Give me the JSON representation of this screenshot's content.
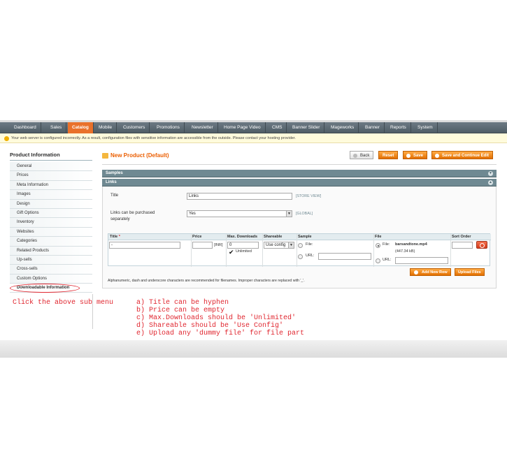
{
  "nav": {
    "items": [
      "Dashboard",
      "Sales",
      "Catalog",
      "Mobile",
      "Customers",
      "Promotions",
      "Newsletter",
      "Home Page Video",
      "CMS",
      "Banner Slider",
      "Mageworks",
      "Banner",
      "Reports",
      "System"
    ],
    "active": "Catalog"
  },
  "notice": {
    "text": "Your web server is configured incorrectly. As a result, configuration files with sensitive information are accessible from the outside. Please contact your hosting provider."
  },
  "sidebar": {
    "title": "Product Information",
    "items": [
      "General",
      "Prices",
      "Meta Information",
      "Images",
      "Design",
      "Gift Options",
      "Inventory",
      "Websites",
      "Categories",
      "Related Products",
      "Up-sells",
      "Cross-sells",
      "Custom Options",
      "Downloadable Information"
    ],
    "selected": "Downloadable Information"
  },
  "header": {
    "title": "New Product (Default)",
    "back_label": "Back",
    "reset_label": "Reset",
    "save_label": "Save",
    "save_continue_label": "Save and Continue Edit"
  },
  "sections": {
    "samples": "Samples",
    "links": "Links"
  },
  "links_form": {
    "title_label": "Title",
    "title_value": "Links",
    "title_scope": "[STORE VIEW]",
    "purchase_label_line1": "Links can be purchased",
    "purchase_label_line2": "separately",
    "purchase_value": "Yes",
    "purchase_scope": "[GLOBAL]"
  },
  "grid": {
    "headers": {
      "title": "Title",
      "required_mark": "*",
      "price": "Price",
      "max_downloads": "Max. Downloads",
      "shareable": "Shareable",
      "sample": "Sample",
      "file": "File",
      "sort_order": "Sort Order"
    },
    "row": {
      "title_value": "-",
      "price_currency": "[INR]",
      "max_downloads_value": "0",
      "unlimited_label": "Unlimited",
      "shareable_value": "Use config",
      "sample_file_label": "File:",
      "sample_url_label": "URL:",
      "file_label": "File:",
      "file_name": "barsandtone.mp4",
      "file_size": "(447.34 kB)",
      "file_url_label": "URL:"
    },
    "add_new_row_label": "Add New Row",
    "upload_files_label": "Upload Files",
    "note": "Alphanumeric, dash and underscore characters are recommended for filenames. Improper characters are replaced with '_'."
  },
  "annotations": {
    "click_hint": "Click the above sub menu",
    "lines": [
      "a) Title can be hyphen",
      "b) Price can be empty",
      "c) Max.Downloads should be 'Unlimited'",
      "d) Shareable should be 'Use Config'",
      "e) Upload any 'dummy file' for file part"
    ]
  },
  "colors": {
    "accent": "#eb5e00",
    "nav_bg": "#5f6d76",
    "section_bar": "#6f8992",
    "annotation": "#e0262f"
  }
}
